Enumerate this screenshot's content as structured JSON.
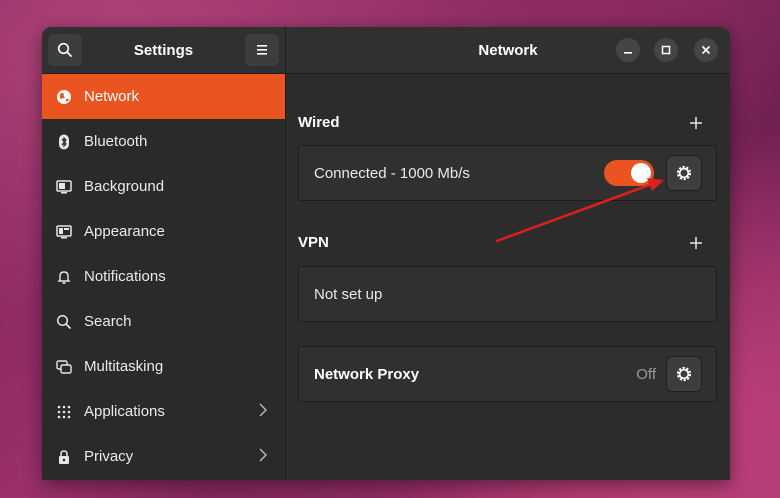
{
  "sidebar": {
    "title": "Settings",
    "items": [
      {
        "label": "Network",
        "icon": "globe-icon",
        "active": true
      },
      {
        "label": "Bluetooth",
        "icon": "bluetooth-icon"
      },
      {
        "label": "Background",
        "icon": "monitor-icon"
      },
      {
        "label": "Appearance",
        "icon": "appearance-icon"
      },
      {
        "label": "Notifications",
        "icon": "bell-icon"
      },
      {
        "label": "Search",
        "icon": "search-icon"
      },
      {
        "label": "Multitasking",
        "icon": "multitasking-icon"
      },
      {
        "label": "Applications",
        "icon": "apps-grid-icon",
        "has_chevron": true
      },
      {
        "label": "Privacy",
        "icon": "lock-icon",
        "has_chevron": true
      }
    ]
  },
  "main": {
    "title": "Network",
    "wired": {
      "title": "Wired",
      "status": "Connected - 1000 Mb/s",
      "enabled": true
    },
    "vpn": {
      "title": "VPN",
      "status": "Not set up"
    },
    "proxy": {
      "label": "Network Proxy",
      "status": "Off"
    }
  },
  "colors": {
    "accent": "#e95420",
    "window_bg": "#2c2c2c",
    "annotation_arrow": "#e01e1e"
  }
}
